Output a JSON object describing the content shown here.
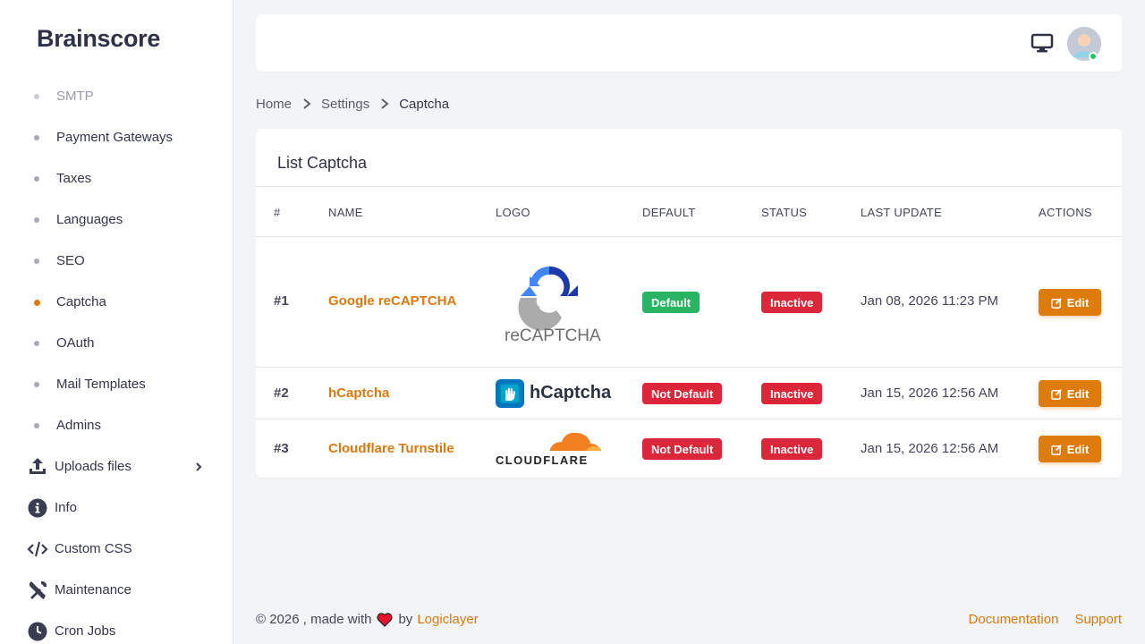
{
  "brand": "Brainscore",
  "sidebar": {
    "sub_items": [
      {
        "label": "SMTP"
      },
      {
        "label": "Payment Gateways"
      },
      {
        "label": "Taxes"
      },
      {
        "label": "Languages"
      },
      {
        "label": "SEO"
      },
      {
        "label": "Captcha"
      },
      {
        "label": "OAuth"
      },
      {
        "label": "Mail Templates"
      },
      {
        "label": "Admins"
      }
    ],
    "main_items": [
      {
        "label": "Uploads files",
        "icon": "upload-icon"
      },
      {
        "label": "Info",
        "icon": "info-icon"
      },
      {
        "label": "Custom CSS",
        "icon": "code-icon"
      },
      {
        "label": "Maintenance",
        "icon": "tools-icon"
      },
      {
        "label": "Cron Jobs",
        "icon": "clock-icon"
      }
    ]
  },
  "breadcrumb": {
    "home": "Home",
    "settings": "Settings",
    "current": "Captcha"
  },
  "card": {
    "title": "List Captcha",
    "headers": [
      "#",
      "NAME",
      "LOGO",
      "DEFAULT",
      "STATUS",
      "LAST UPDATE",
      "ACTIONS"
    ],
    "rows": [
      {
        "num": "#1",
        "name": "Google reCAPTCHA",
        "logo_text": "reCAPTCHA",
        "default": "Default",
        "status": "Inactive",
        "updated": "Jan 08, 2026 11:23 PM",
        "action": "Edit"
      },
      {
        "num": "#2",
        "name": "hCaptcha",
        "logo_text": "hCaptcha",
        "default": "Not Default",
        "status": "Inactive",
        "updated": "Jan 15, 2026 12:56 AM",
        "action": "Edit"
      },
      {
        "num": "#3",
        "name": "Cloudflare Turnstile",
        "logo_text": "CLOUDFLARE",
        "default": "Not Default",
        "status": "Inactive",
        "updated": "Jan 15, 2026 12:56 AM",
        "action": "Edit"
      }
    ]
  },
  "footer": {
    "copyright": "© 2026 , made with",
    "by": "by",
    "company": "Logiclayer",
    "links": [
      "Documentation",
      "Support"
    ]
  },
  "colors": {
    "accent": "#dd7c0c",
    "success": "#28b463",
    "danger": "#dc2639"
  }
}
